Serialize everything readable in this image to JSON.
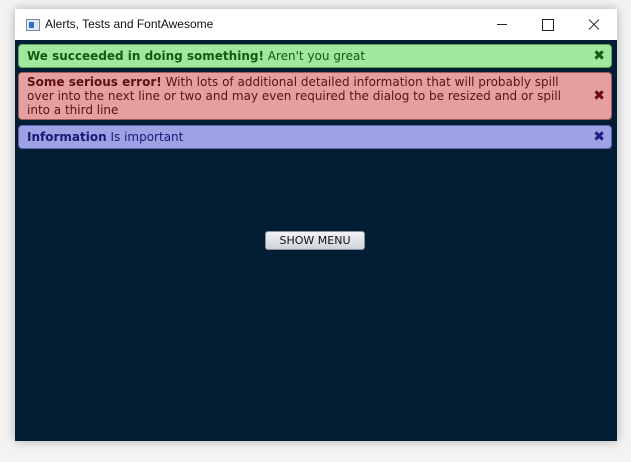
{
  "window": {
    "title": "Alerts, Tests and FontAwesome"
  },
  "alerts": [
    {
      "type": "success",
      "heading": "We succeeded in doing something!",
      "text": "Aren't you great",
      "close_icon": "times-icon",
      "color": "#a0e79f"
    },
    {
      "type": "error",
      "heading": "Some serious error!",
      "text": "With lots of additional detailed information that will probably spill over into the next line or two and may even required the dialog to be resized and or spill into a third line",
      "close_icon": "times-icon",
      "color": "#e49f9f"
    },
    {
      "type": "info",
      "heading": "Information",
      "text": "Is important",
      "close_icon": "times-icon",
      "color": "#9ea1e4"
    }
  ],
  "client": {
    "background": "#011e34",
    "menu_button_label": "SHOW MENU"
  }
}
